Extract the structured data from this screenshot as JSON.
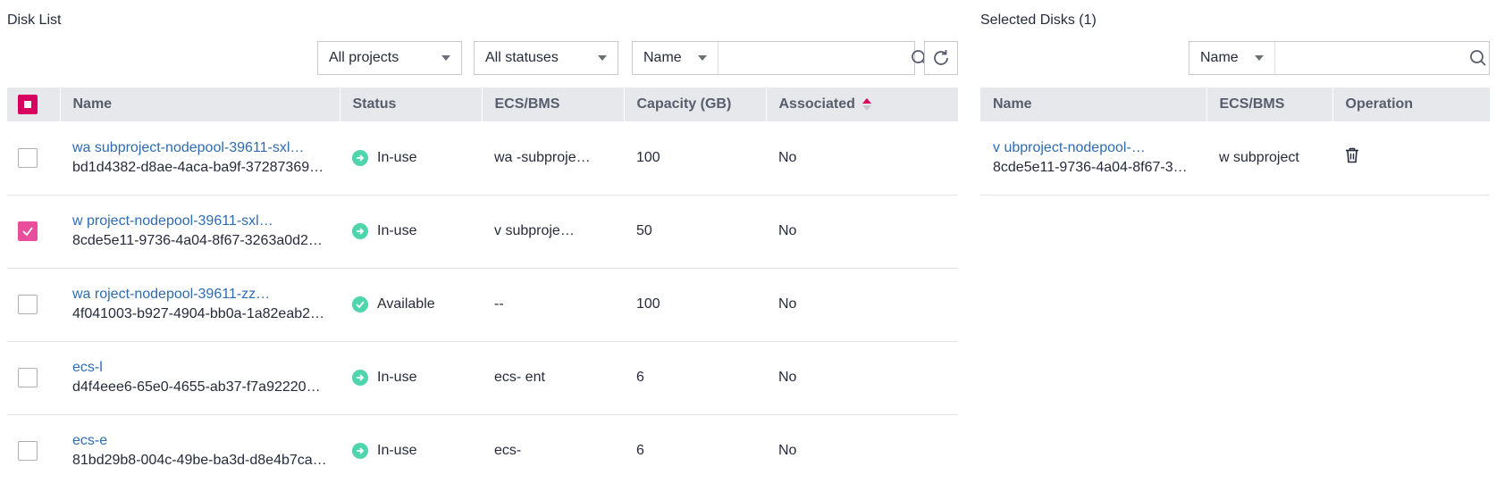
{
  "left": {
    "title": "Disk List",
    "filters": {
      "project": "All projects",
      "status": "All statuses",
      "search_field": "Name",
      "search_value": ""
    },
    "columns": {
      "name": "Name",
      "status": "Status",
      "ecs": "ECS/BMS",
      "capacity": "Capacity (GB)",
      "associated": "Associated"
    },
    "rows": [
      {
        "name": "wa   subproject-nodepool-39611-sxl…",
        "id": "bd1d4382-d8ae-4aca-ba9f-37287369…",
        "status": "In-use",
        "ecs": "wa   -subproje…",
        "capacity": "100",
        "associated": "No",
        "checked": false
      },
      {
        "name": "w        project-nodepool-39611-sxl…",
        "id": "8cde5e11-9736-4a04-8f67-3263a0d2…",
        "status": "In-use",
        "ecs": "v      subproje…",
        "capacity": "50",
        "associated": "No",
        "checked": true
      },
      {
        "name": "wa        roject-nodepool-39611-zz…",
        "id": "4f041003-b927-4904-bb0a-1a82eab2…",
        "status": "Available",
        "ecs": "--",
        "capacity": "100",
        "associated": "No",
        "checked": false
      },
      {
        "name": "ecs-l",
        "id": "d4f4eee6-65e0-4655-ab37-f7a92220…",
        "status": "In-use",
        "ecs": "ecs-       ent",
        "capacity": "6",
        "associated": "No",
        "checked": false
      },
      {
        "name": "ecs-e",
        "id": "81bd29b8-004c-49be-ba3d-d8e4b7ca…",
        "status": "In-use",
        "ecs": "ecs-",
        "capacity": "6",
        "associated": "No",
        "checked": false
      }
    ]
  },
  "right": {
    "title": "Selected Disks (1)",
    "search_field": "Name",
    "search_value": "",
    "columns": {
      "name": "Name",
      "ecs": "ECS/BMS",
      "operation": "Operation"
    },
    "rows": [
      {
        "name": "v          ubproject-nodepool-…",
        "id": "8cde5e11-9736-4a04-8f67-3…",
        "ecs": "w      subproject"
      }
    ]
  },
  "colors": {
    "accent": "#d8005f",
    "checked": "#e84e9c",
    "link": "#2e6bb1",
    "status_ok": "#50d4ab"
  }
}
